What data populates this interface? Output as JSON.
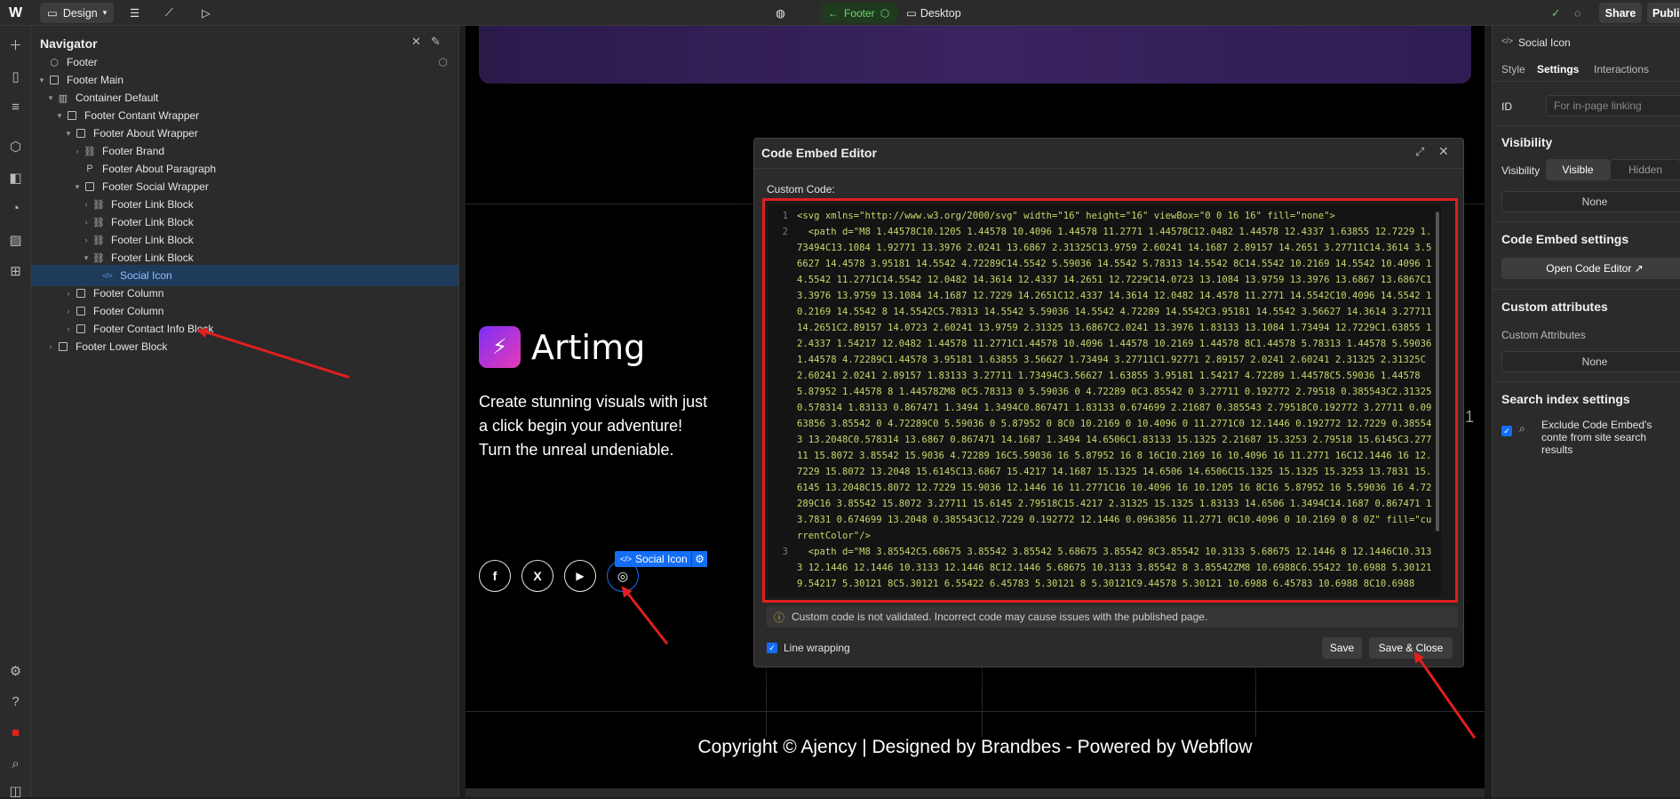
{
  "topbar": {
    "mode_label": "Design",
    "footer_label": "Footer",
    "breakpoint_label": "Desktop",
    "share_label": "Share",
    "publish_label": "Publi"
  },
  "navigator": {
    "title": "Navigator",
    "items": [
      {
        "label": "Footer",
        "depth": 0,
        "icon": "component-icon"
      },
      {
        "label": "Footer Main",
        "depth": 0,
        "icon": "box-icon"
      },
      {
        "label": "Container Default",
        "depth": 1,
        "icon": "container-icon"
      },
      {
        "label": "Footer Contant Wrapper",
        "depth": 2,
        "icon": "box-icon"
      },
      {
        "label": "Footer About Wrapper",
        "depth": 3,
        "icon": "box-icon"
      },
      {
        "label": "Footer Brand",
        "depth": 4,
        "icon": "link-icon"
      },
      {
        "label": "Footer About Paragraph",
        "depth": 4,
        "icon": "paragraph-icon"
      },
      {
        "label": "Footer Social Wrapper",
        "depth": 4,
        "icon": "box-icon"
      },
      {
        "label": "Footer Link Block",
        "depth": 5,
        "icon": "link-icon"
      },
      {
        "label": "Footer Link Block",
        "depth": 5,
        "icon": "link-icon"
      },
      {
        "label": "Footer Link Block",
        "depth": 5,
        "icon": "link-icon"
      },
      {
        "label": "Footer Link Block",
        "depth": 5,
        "icon": "link-icon"
      },
      {
        "label": "Social Icon",
        "depth": 6,
        "icon": "embed-icon"
      },
      {
        "label": "Footer Column",
        "depth": 3,
        "icon": "box-icon"
      },
      {
        "label": "Footer Column",
        "depth": 3,
        "icon": "box-icon"
      },
      {
        "label": "Footer Contact Info Block",
        "depth": 3,
        "icon": "box-icon"
      },
      {
        "label": "Footer Lower Block",
        "depth": 1,
        "icon": "box-icon"
      }
    ]
  },
  "canvas": {
    "brand": "Artimg",
    "tagline": "Create stunning visuals with just a click begin your adventure! Turn the unreal undeniable.",
    "selected_tag": "Social Icon",
    "copyright": "Copyright © Ajency | Designed by Brandbes - Powered by Webflow",
    "edge_number": "1"
  },
  "modal": {
    "title": "Code Embed Editor",
    "custom_code_label": "Custom Code:",
    "line1": "<svg xmlns=\"http://www.w3.org/2000/svg\" width=\"16\" height=\"16\" viewBox=\"0 0 16 16\" fill=\"none\">",
    "line2": "  <path d=\"M8 1.44578C10.1205 1.44578 10.4096 1.44578 11.2771 1.44578C12.0482 1.44578 12.4337 1.63855 12.7229 1.73494C13.1084 1.92771 13.3976 2.0241 13.6867 2.31325C13.9759 2.60241 14.1687 2.89157 14.2651 3.27711C14.3614 3.56627 14.4578 3.95181 14.5542 4.72289C14.5542 5.59036 14.5542 5.78313 14.5542 8C14.5542 10.2169 14.5542 10.4096 14.5542 11.2771C14.5542 12.0482 14.3614 12.4337 14.2651 12.7229C14.0723 13.1084 13.9759 13.3976 13.6867 13.6867C13.3976 13.9759 13.1084 14.1687 12.7229 14.2651C12.4337 14.3614 12.0482 14.4578 11.2771 14.5542C10.4096 14.5542 10.2169 14.5542 8 14.5542C5.78313 14.5542 5.59036 14.5542 4.72289 14.5542C3.95181 14.5542 3.56627 14.3614 3.27711 14.2651C2.89157 14.0723 2.60241 13.9759 2.31325 13.6867C2.0241 13.3976 1.83133 13.1084 1.73494 12.7229C1.63855 12.4337 1.54217 12.0482 1.44578 11.2771C1.44578 10.4096 1.44578 10.2169 1.44578 8C1.44578 5.78313 1.44578 5.59036 1.44578 4.72289C1.44578 3.95181 1.63855 3.56627 1.73494 3.27711C1.92771 2.89157 2.0241 2.60241 2.31325 2.31325C2.60241 2.0241 2.89157 1.83133 3.27711 1.73494C3.56627 1.63855 3.95181 1.54217 4.72289 1.44578C5.59036 1.44578 5.87952 1.44578 8 1.44578ZM8 0C5.78313 0 5.59036 0 4.72289 0C3.85542 0 3.27711 0.192772 2.79518 0.385543C2.31325 0.578314 1.83133 0.867471 1.3494 1.3494C0.867471 1.83133 0.674699 2.21687 0.385543 2.79518C0.192772 3.27711 0.0963856 3.85542 0 4.72289C0 5.59036 0 5.87952 0 8C0 10.2169 0 10.4096 0 11.2771C0 12.1446 0.192772 12.7229 0.385543 13.2048C0.578314 13.6867 0.867471 14.1687 1.3494 14.6506C1.83133 15.1325 2.21687 15.3253 2.79518 15.6145C3.27711 15.8072 3.85542 15.9036 4.72289 16C5.59036 16 5.87952 16 8 16C10.2169 16 10.4096 16 11.2771 16C12.1446 16 12.7229 15.8072 13.2048 15.6145C13.6867 15.4217 14.1687 15.1325 14.6506 14.6506C15.1325 15.1325 15.3253 13.7831 15.6145 13.2048C15.8072 12.7229 15.9036 12.1446 16 11.2771C16 10.4096 16 10.1205 16 8C16 5.87952 16 5.59036 16 4.72289C16 3.85542 15.8072 3.27711 15.6145 2.79518C15.4217 2.31325 15.1325 1.83133 14.6506 1.3494C14.1687 0.867471 13.7831 0.674699 13.2048 0.385543C12.7229 0.192772 12.1446 0.0963856 11.2771 0C10.4096 0 10.2169 0 8 0Z\" fill=\"currentColor\"/>",
    "line3": "  <path d=\"M8 3.85542C5.68675 3.85542 3.85542 5.68675 3.85542 8C3.85542 10.3133 5.68675 12.1446 8 12.1446C10.3133 12.1446 12.1446 10.3133 12.1446 8C12.1446 5.68675 10.3133 3.85542 8 3.85542ZM8 10.6988C6.55422 10.6988 5.30121 9.54217 5.30121 8C5.30121 6.55422 6.45783 5.30121 8 5.30121C9.44578 5.30121 10.6988 6.45783 10.6988 8C10.6988",
    "warning": "Custom code is not validated. Incorrect code may cause issues with the published page.",
    "line_wrapping_label": "Line wrapping",
    "save_label": "Save",
    "save_close_label": "Save & Close"
  },
  "right_panel": {
    "element": "Social Icon",
    "tabs": [
      "Style",
      "Settings",
      "Interactions"
    ],
    "id_label": "ID",
    "id_placeholder": "For in-page linking",
    "visibility_heading": "Visibility",
    "visibility_label": "Visibility",
    "visible": "Visible",
    "hidden": "Hidden",
    "none1": "None",
    "code_embed_heading": "Code Embed settings",
    "open_code_editor": "Open Code Editor ↗",
    "custom_attrs_heading": "Custom attributes",
    "custom_attrs_label": "Custom Attributes",
    "none2": "None",
    "search_heading": "Search index settings",
    "exclude_label": "Exclude Code Embed's conte from site search results"
  },
  "colors": {
    "accent": "#146ef5",
    "annotation": "#e01f1f",
    "success": "#6fd36f"
  }
}
